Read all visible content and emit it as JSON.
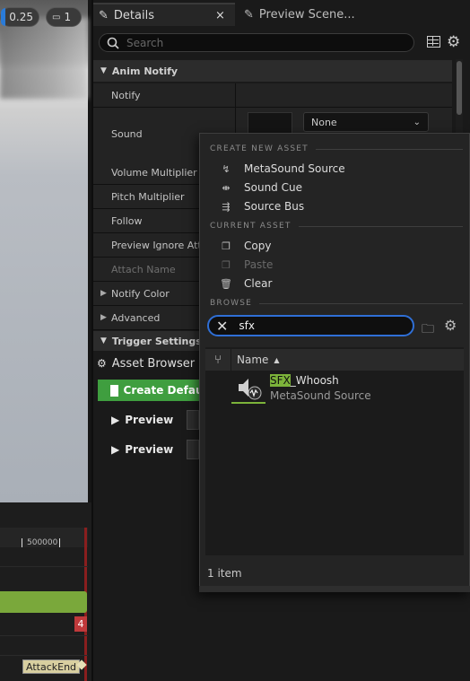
{
  "viewport": {
    "speed": "0.25",
    "camera_count": "1"
  },
  "timeline": {
    "marker": "500000",
    "notify_count": "4",
    "notify_label": "AttackEnd"
  },
  "tabs": [
    {
      "label": "Details",
      "close": "×"
    },
    {
      "label": "Preview Scene..."
    }
  ],
  "search": {
    "placeholder": "Search"
  },
  "sections": {
    "anim_notify": "Anim Notify",
    "trigger_settings": "Trigger Settings"
  },
  "properties": [
    {
      "label": "Notify"
    },
    {
      "label": "Sound",
      "value": "None"
    },
    {
      "label": "Volume Multiplier"
    },
    {
      "label": "Pitch Multiplier"
    },
    {
      "label": "Follow"
    },
    {
      "label": "Preview Ignore Atte"
    },
    {
      "label": "Attach Name"
    },
    {
      "label": "Notify Color"
    },
    {
      "label": "Advanced"
    }
  ],
  "lower": {
    "asset_browser": "Asset Browser",
    "create_default": "Create Default",
    "preview1": "Preview",
    "preview2": "Preview"
  },
  "popup": {
    "headers": {
      "create_new": "CREATE NEW ASSET",
      "current": "CURRENT ASSET",
      "browse": "BROWSE"
    },
    "create_items": [
      "MetaSound Source",
      "Sound Cue",
      "Source Bus"
    ],
    "current_items": [
      "Copy",
      "Paste",
      "Clear"
    ],
    "browse_query": "sfx",
    "column_name": "Name",
    "asset": {
      "name_highlight": "SFX",
      "name_rest": "_Whoosh",
      "type": "MetaSound Source"
    },
    "item_count": "1 item"
  },
  "colors": {
    "accent_blue": "#2f6fd6",
    "highlight_green": "#7cb33a",
    "create_button_green": "#3f9e3f",
    "notify_red": "#c0393b"
  }
}
